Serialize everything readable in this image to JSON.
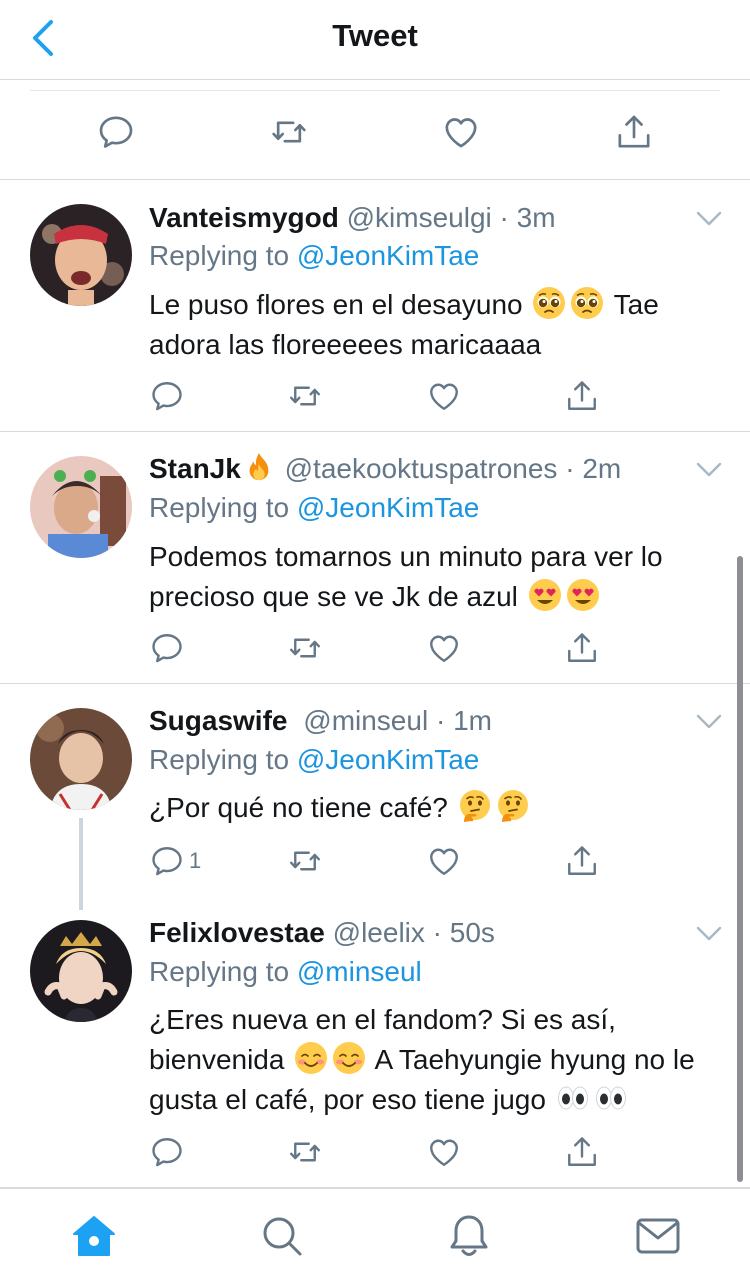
{
  "header": {
    "title": "Tweet"
  },
  "colors": {
    "accent": "#1da1f2",
    "mention": "#1b95e0",
    "muted": "#657786",
    "text": "#14171a",
    "divider": "#d6dbe0"
  },
  "tweets": [
    {
      "name": "Vanteismygod",
      "handle": "@kimseulgi",
      "dot": "·",
      "time": "3m",
      "replying_prefix": "Replying to ",
      "replying_to": "@JeonKimTae",
      "text_parts": [
        "Le puso flores en el desayuno",
        "Tae adora las floreeeees maricaaaa"
      ],
      "emojis": [
        "pleading-face-emoji",
        "pleading-face-emoji"
      ],
      "reply_count": ""
    },
    {
      "name": "StanJk",
      "name_emoji": "fire-emoji",
      "handle": "@taekooktuspatrones",
      "dot": "·",
      "time": "2m",
      "replying_prefix": "Replying to ",
      "replying_to": "@JeonKimTae",
      "text_parts": [
        "Podemos tomarnos un minuto para ver lo precioso que se ve Jk de azul"
      ],
      "emojis": [
        "heart-eyes-emoji",
        "heart-eyes-emoji"
      ],
      "reply_count": ""
    },
    {
      "name": "Sugaswife",
      "handle": "@minseul",
      "dot": "·",
      "time": "1m",
      "replying_prefix": "Replying to ",
      "replying_to": "@JeonKimTae",
      "text_parts": [
        "¿Por qué no tiene café?"
      ],
      "emojis": [
        "thinking-face-emoji",
        "thinking-face-emoji"
      ],
      "reply_count": "1"
    },
    {
      "name": "Felixlovestae",
      "handle": "@leelix",
      "dot": "·",
      "time": "50s",
      "replying_prefix": "Replying to ",
      "replying_to": "@minseul",
      "text_parts": [
        "¿Eres nueva en el fandom? Si es así, bienvenida",
        "A Taehyungie hyung no le gusta el café, por eso tiene jugo"
      ],
      "emojis": [
        "smiling-face-emoji",
        "smiling-face-emoji",
        "eyes-emoji",
        "eyes-emoji"
      ],
      "reply_count": ""
    }
  ],
  "tabbar": {
    "items": [
      "home-icon",
      "search-icon",
      "notifications-icon",
      "messages-icon"
    ],
    "active": "home-icon"
  }
}
